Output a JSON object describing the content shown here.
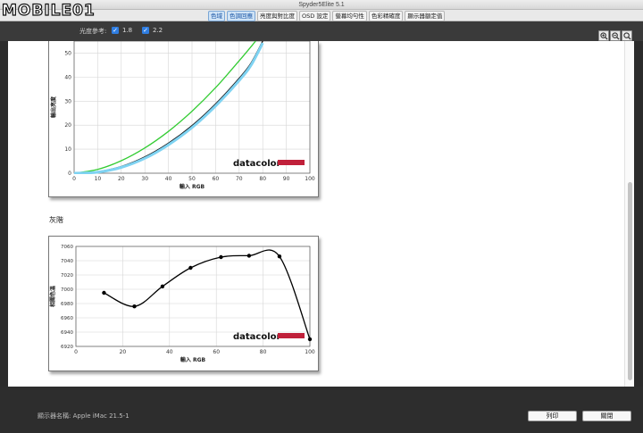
{
  "window": {
    "title": "Spyder5Elite 5.1"
  },
  "logo": {
    "text": "MOBILE01"
  },
  "tabs": [
    {
      "label": "色域",
      "active": false
    },
    {
      "label": "色調回應",
      "active": true
    },
    {
      "label": "亮度與對比度",
      "active": false
    },
    {
      "label": "OSD 設定",
      "active": false
    },
    {
      "label": "螢幕均勻性",
      "active": false
    },
    {
      "label": "色彩精確度",
      "active": false
    },
    {
      "label": "顯示器額定值",
      "active": false
    }
  ],
  "header": {
    "reference_label": "光度參考:",
    "options": [
      {
        "label": "1.8",
        "checked": true
      },
      {
        "label": "2.2",
        "checked": true
      }
    ],
    "zoom_buttons": [
      "zoom-in-icon",
      "zoom-out-icon",
      "zoom-fit-icon"
    ]
  },
  "gray_section_title": "灰階",
  "footer": {
    "display_name": "顯示器名稱: Apple iMac 21.5-1",
    "print_button": "列印",
    "close_button": "關閉"
  },
  "chart_data": [
    {
      "type": "line",
      "title": "",
      "xlabel": "輸入 RGB",
      "ylabel": "輸出亮度",
      "brand": "datacolor",
      "xlim": [
        0,
        100
      ],
      "ylim": [
        0,
        55
      ],
      "xticks": [
        0,
        10,
        20,
        30,
        40,
        50,
        60,
        70,
        80,
        90,
        100
      ],
      "yticks": [
        0,
        10,
        20,
        30,
        40,
        50
      ],
      "series": [
        {
          "color": "#33cc33",
          "x": [
            0,
            10,
            20,
            30,
            40,
            50,
            60,
            70,
            77
          ],
          "y": [
            0,
            1.6,
            5.2,
            10.5,
            17.4,
            25.8,
            35.6,
            46.8,
            55
          ]
        },
        {
          "color": "#111111",
          "x": [
            0,
            10,
            20,
            30,
            40,
            50,
            60,
            70,
            75,
            80
          ],
          "y": [
            0,
            0.6,
            2.8,
            6.8,
            12.5,
            19.8,
            28.8,
            39.5,
            45.8,
            55
          ]
        },
        {
          "color": "#7fd3f2",
          "x": [
            0,
            10,
            20,
            30,
            40,
            50,
            60,
            70,
            75,
            80
          ],
          "y": [
            0,
            0.4,
            2.4,
            6.2,
            11.8,
            19.0,
            28.0,
            38.6,
            44.9,
            54.2
          ]
        }
      ]
    },
    {
      "type": "line",
      "title": "",
      "xlabel": "輸入 RGB",
      "ylabel": "相關色溫",
      "brand": "datacolor",
      "xlim": [
        0,
        100
      ],
      "ylim": [
        6920,
        7060
      ],
      "xticks": [
        0,
        20,
        40,
        60,
        80,
        100
      ],
      "yticks": [
        6920,
        6940,
        6960,
        6980,
        7000,
        7020,
        7040,
        7060
      ],
      "ytick_labels": [
        "6920",
        "6940",
        "6960",
        "6980",
        "7000",
        "7020",
        "7040",
        "7060"
      ],
      "series": [
        {
          "color": "#000000",
          "x": [
            12,
            25,
            37,
            49,
            62,
            74,
            87,
            100
          ],
          "y": [
            6995,
            6976,
            7004,
            7030,
            7045,
            7047,
            7046,
            6930
          ]
        }
      ]
    }
  ]
}
